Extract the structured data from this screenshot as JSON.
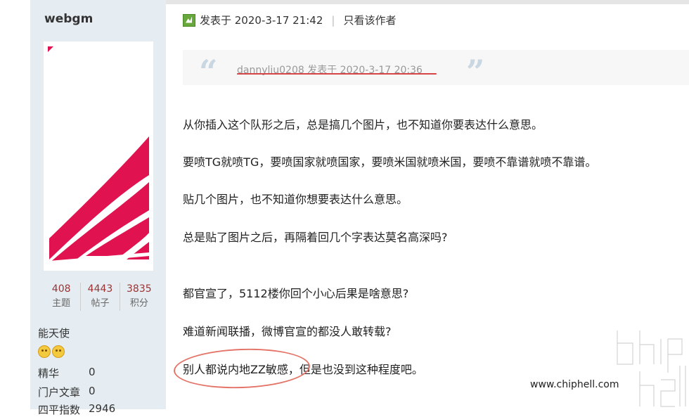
{
  "author": {
    "username": "webgm",
    "stats": [
      {
        "value": "408",
        "label": "主题"
      },
      {
        "value": "4443",
        "label": "帖子"
      },
      {
        "value": "3835",
        "label": "积分"
      }
    ],
    "rank": "能天使",
    "info": [
      {
        "key": "精华",
        "value": "0"
      },
      {
        "key": "门户文章",
        "value": "0"
      },
      {
        "key": "四平指数",
        "value": "2946"
      }
    ]
  },
  "post": {
    "posted_at": "发表于 2020-3-17 21:42",
    "separator": "|",
    "author_only_label": "只看该作者",
    "quote": {
      "open_mark": "“",
      "close_mark": "”",
      "text": "dannyliu0208 发表于 2020-3-17 20:36"
    },
    "paragraphs": [
      "从你插入这个队形之后，总是搞几个图片，也不知道你要表达什么意思。",
      "要喷TG就喷TG，要喷国家就喷国家，要喷米国就喷米国，要喷不靠谱就喷不靠谱。",
      "贴几个图片，也不知道你想要表达什么意思。",
      "总是贴了图片之后，再隔着回几个字表达莫名高深吗?",
      "都官宣了，5112楼你回个小心后果是啥意思?",
      "难道新闻联播，微博官宣的都没人敢转载?",
      "别人都说内地ZZ敏感，但是也没到这种程度吧。"
    ]
  },
  "watermark": {
    "logo_text": "chip hell",
    "url": "www.chiphell.com"
  },
  "colors": {
    "sidebar_bg": "#e5edf2",
    "stat_number": "#993333",
    "avatar_red": "#e0124f",
    "annotation_red": "#e57468"
  }
}
